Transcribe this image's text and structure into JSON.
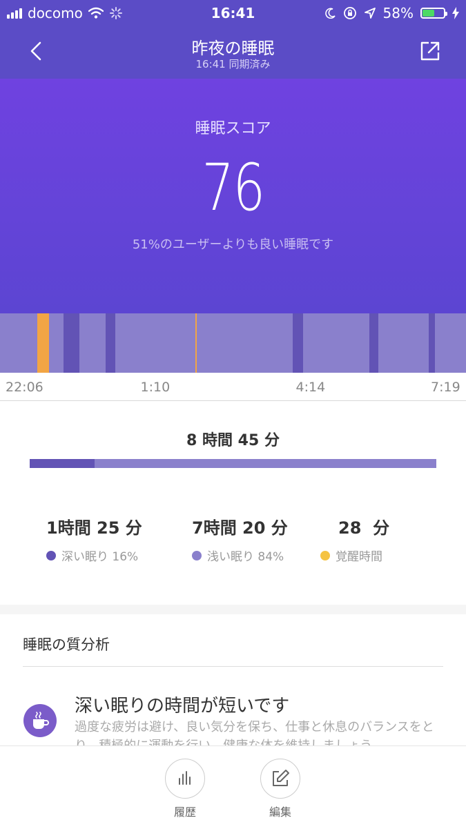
{
  "status_bar": {
    "carrier": "docomo",
    "time": "16:41",
    "battery_percent": "58%",
    "battery_level": 0.58,
    "icons": [
      "signal-icon",
      "wifi-icon",
      "loading-icon",
      "moon-icon",
      "rotation-lock-icon",
      "location-icon",
      "battery-icon",
      "charging-icon"
    ]
  },
  "header": {
    "title": "昨夜の睡眠",
    "subtitle": "16:41 同期済み",
    "back_icon": "chevron-left-icon",
    "share_icon": "share-icon"
  },
  "hero": {
    "score_label": "睡眠スコア",
    "score_value": "76",
    "compare_text": "51%のユーザーよりも良い睡眠です"
  },
  "chart_data": {
    "type": "timeline",
    "x_start": "22:06",
    "x_end": "7:19",
    "tick_labels": [
      "22:06",
      "1:10",
      "4:14",
      "7:19"
    ],
    "segments": [
      {
        "stage": "awake",
        "start": "22:50",
        "end": "23:04"
      },
      {
        "stage": "deep",
        "start": "23:21",
        "end": "23:40"
      },
      {
        "stage": "deep",
        "start": "0:11",
        "end": "0:23"
      },
      {
        "stage": "awake",
        "start": "1:58",
        "end": "1:59"
      },
      {
        "stage": "deep",
        "start": "3:53",
        "end": "4:06"
      },
      {
        "stage": "deep",
        "start": "5:24",
        "end": "5:35"
      },
      {
        "stage": "deep",
        "start": "6:35",
        "end": "6:42"
      }
    ],
    "colors": {
      "light": "#8a80cc",
      "deep": "#6253b5",
      "awake": "#f2a544"
    }
  },
  "summary": {
    "total": "8 時間 45 分",
    "deep_fraction": 0.16,
    "stats": [
      {
        "value": "1時間 25 分",
        "label": "深い眠り 16%",
        "color": "#6253b5"
      },
      {
        "value": "7時間 20 分",
        "label": "浅い眠り 84%",
        "color": "#8a80cc"
      },
      {
        "value": "28  分",
        "label": "覚醒時間",
        "color": "#f5c342"
      }
    ]
  },
  "analysis": {
    "title": "睡眠の質分析",
    "item_icon": "coffee-cup-icon",
    "item_heading": "深い眠りの時間が短いです",
    "item_body": "過度な疲労は避け、良い気分を保ち、仕事と休息のバランスをとり、積極的に運動を行い、健康な体を維持しましょう"
  },
  "bottom_bar": {
    "history_label": "履歴",
    "history_icon": "bar-chart-icon",
    "edit_label": "編集",
    "edit_icon": "edit-icon"
  }
}
